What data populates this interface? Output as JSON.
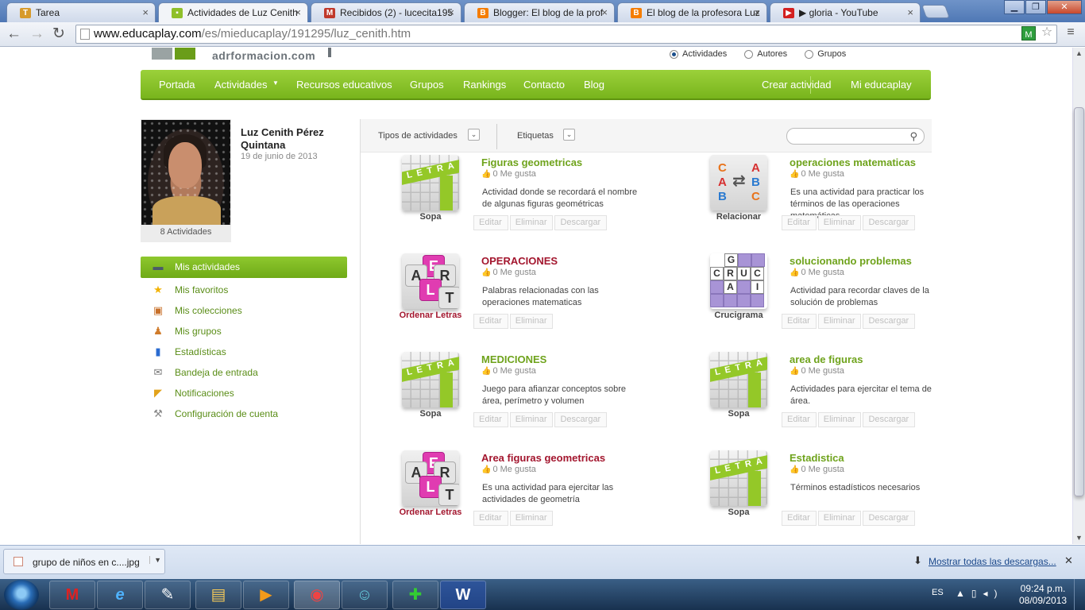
{
  "tabs": [
    {
      "title": "Tarea",
      "icon": "tarea-icon",
      "color": "#d79a2b",
      "glyph": "T"
    },
    {
      "title": "Actividades de Luz Cenith",
      "icon": "educaplay-icon",
      "color": "#8fbf2a",
      "glyph": "▪",
      "active": true
    },
    {
      "title": "Recibidos (2) - lucecita195",
      "icon": "gmail-icon",
      "color": "#c0392b",
      "glyph": "M"
    },
    {
      "title": "Blogger: El blog de la prof",
      "icon": "blogger-icon",
      "color": "#f57d00",
      "glyph": "B"
    },
    {
      "title": "El blog de la profesora Luz",
      "icon": "blogger-icon",
      "color": "#f57d00",
      "glyph": "B"
    },
    {
      "title": "▶ gloria - YouTube",
      "icon": "youtube-icon",
      "color": "#d32020",
      "glyph": "▶"
    }
  ],
  "address": {
    "domain": "www.educaplay.com",
    "path": "/es/mieducaplay/191295/luz_cenith.htm"
  },
  "header": {
    "brand": "adrformacion.com"
  },
  "search_scope": [
    "Actividades",
    "Autores",
    "Grupos"
  ],
  "mainnav": {
    "left": [
      "Portada",
      "Actividades",
      "Recursos educativos",
      "Grupos",
      "Rankings",
      "Contacto",
      "Blog"
    ],
    "right": [
      "Crear actividad",
      "Mi educaplay"
    ]
  },
  "profile": {
    "name": "Luz Cenith Pérez Quintana",
    "date": "19 de junio de 2013",
    "activities": "8 Actividades"
  },
  "sidemenu": [
    {
      "label": "Mis actividades",
      "icon": "folder-icon",
      "glyph": "▬",
      "color": "#555",
      "active": true
    },
    {
      "label": "Mis favoritos",
      "icon": "star-icon",
      "glyph": "★",
      "color": "#f2b200"
    },
    {
      "label": "Mis colecciones",
      "icon": "box-icon",
      "glyph": "▣",
      "color": "#c8702a"
    },
    {
      "label": "Mis grupos",
      "icon": "group-icon",
      "glyph": "♟",
      "color": "#d07b2a"
    },
    {
      "label": "Estadísticas",
      "icon": "chart-icon",
      "glyph": "▮",
      "color": "#2a6bd0"
    },
    {
      "label": "Bandeja de entrada",
      "icon": "mail-icon",
      "glyph": "✉",
      "color": "#777"
    },
    {
      "label": "Notificaciones",
      "icon": "megaphone-icon",
      "glyph": "◤",
      "color": "#e2a21a"
    },
    {
      "label": "Configuración de cuenta",
      "icon": "wrench-icon",
      "glyph": "⚒",
      "color": "#888"
    }
  ],
  "filters": {
    "types": "Tipos de actividades",
    "tags": "Etiquetas"
  },
  "actions": {
    "edit": "Editar",
    "delete": "Eliminar",
    "download": "Descargar"
  },
  "likes_label": "0 Me gusta",
  "activities": [
    {
      "title": "Figuras geometricas",
      "type": "Sopa",
      "kind": "sopa",
      "desc": "Actividad donde se recordará el nombre de algunas figuras geométricas",
      "download": true
    },
    {
      "title": "operaciones matematicas",
      "type": "Relacionar",
      "kind": "rel",
      "desc": "Es una actividad para practicar los términos de las operaciones matemáticas.",
      "download": true
    },
    {
      "title": "OPERACIONES",
      "type": "Ordenar Letras",
      "kind": "ord",
      "desc": "Palabras relacionadas con las operaciones matematicas",
      "download": false
    },
    {
      "title": "solucionando problemas",
      "type": "Crucigrama",
      "kind": "cruc",
      "desc": "Actividad para recordar claves de la solución de problemas",
      "download": true
    },
    {
      "title": "MEDICIONES",
      "type": "Sopa",
      "kind": "sopa",
      "desc": "Juego para afianzar conceptos sobre área, perímetro y volumen",
      "download": true
    },
    {
      "title": "area de figuras",
      "type": "Sopa",
      "kind": "sopa",
      "desc": "Actividades para ejercitar el tema de área.",
      "download": true
    },
    {
      "title": "Area figuras geometricas",
      "type": "Ordenar Letras",
      "kind": "ord",
      "desc": "Es una actividad para ejercitar las actividades de geometría",
      "download": false
    },
    {
      "title": "Estadistica",
      "type": "Sopa",
      "kind": "sopa",
      "desc": "Términos estadísticos necesarios",
      "download": true
    }
  ],
  "downloads": {
    "file": "grupo de niños en c....jpg",
    "show_all": "Mostrar todas las descargas..."
  },
  "taskbar": {
    "lang": "ES",
    "time": "09:24 p.m.",
    "date": "08/09/2013"
  }
}
